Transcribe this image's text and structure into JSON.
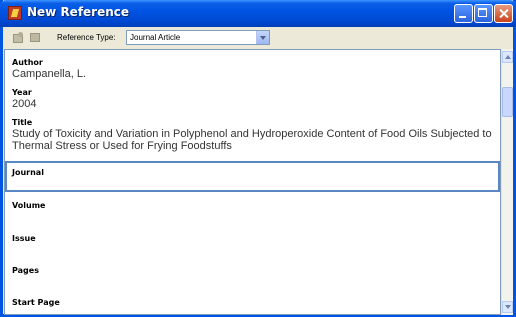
{
  "window": {
    "title": "New Reference",
    "accent_color": "#0054e3"
  },
  "toolbar": {
    "icons": [
      "reference-icon",
      "folder-icon"
    ],
    "ref_type_label": "Reference Type:",
    "ref_type_value": "Journal Article"
  },
  "fields": {
    "author": {
      "label": "Author",
      "value": "Campanella, L."
    },
    "year": {
      "label": "Year",
      "value": "2004"
    },
    "title": {
      "label": "Title",
      "value_line1": "Study of Toxicity and Variation in Polyphenol and Hydroperoxide Content of Food Oils Subjected to",
      "value_line2": "Thermal Stress or Used for Frying Foodstuffs"
    },
    "journal": {
      "label": "Journal",
      "value": ""
    },
    "volume": {
      "label": "Volume",
      "value": ""
    },
    "issue": {
      "label": "Issue",
      "value": ""
    },
    "pages": {
      "label": "Pages",
      "value": ""
    },
    "start_page": {
      "label": "Start Page",
      "value": ""
    }
  }
}
